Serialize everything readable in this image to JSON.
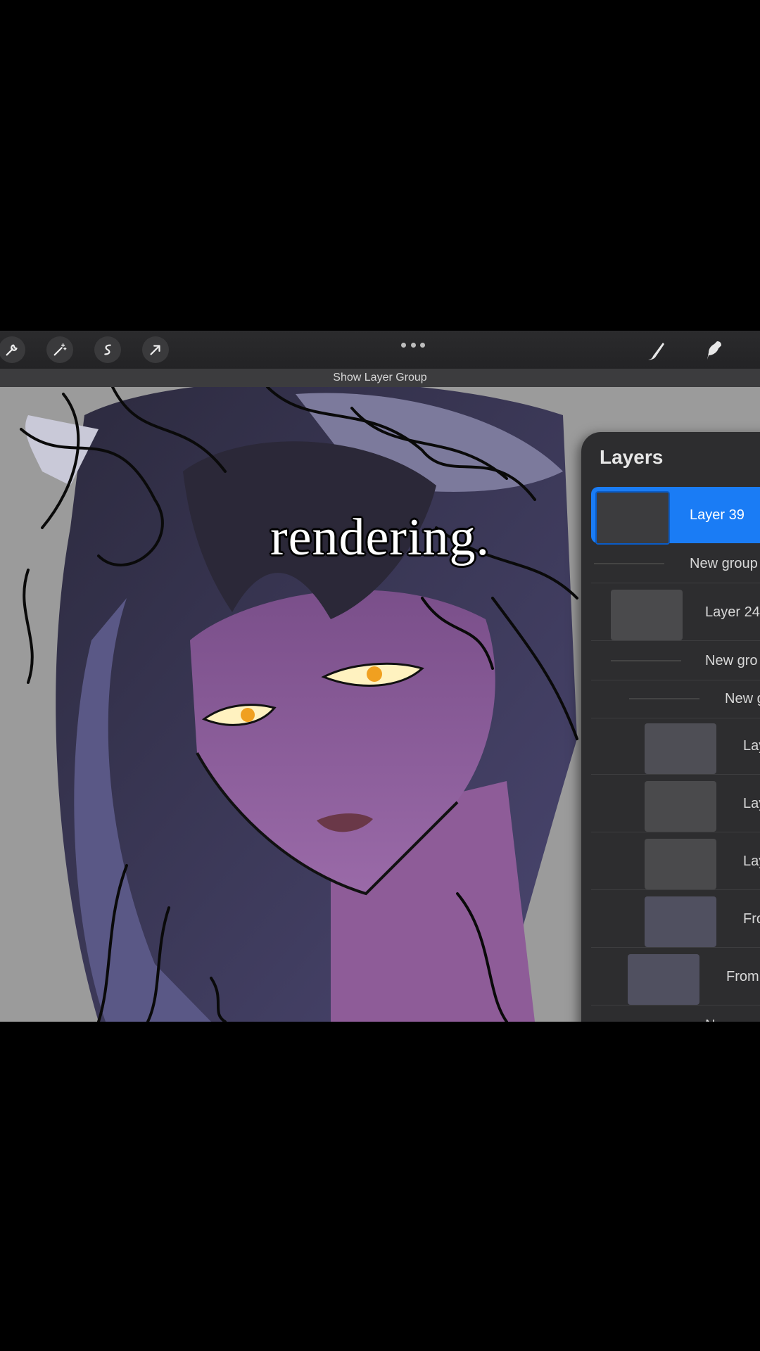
{
  "toolbar": {
    "left_tools": [
      "wrench-icon",
      "magic-wand-icon",
      "selection-icon",
      "transform-arrow-icon"
    ],
    "more": "more-options-icon",
    "right_tools": [
      "brush-icon",
      "smudge-icon"
    ]
  },
  "banner": "Show Layer Group",
  "caption": "rendering.",
  "layers": {
    "title": "Layers",
    "items": [
      {
        "label": "Layer 39",
        "selected": true
      },
      {
        "label": "New group"
      },
      {
        "label": "Layer 24"
      },
      {
        "label": "New gro"
      },
      {
        "label": "New g"
      },
      {
        "label": "Lay"
      },
      {
        "label": "Lay"
      },
      {
        "label": "Lay"
      },
      {
        "label": "Fro"
      },
      {
        "label": "From"
      },
      {
        "label": "New gro"
      }
    ]
  },
  "colors": {
    "accent": "#1a7cf5",
    "panel": "#2d2d2f",
    "toolbar": "#232325",
    "canvas_bg": "#9b9b9b"
  }
}
